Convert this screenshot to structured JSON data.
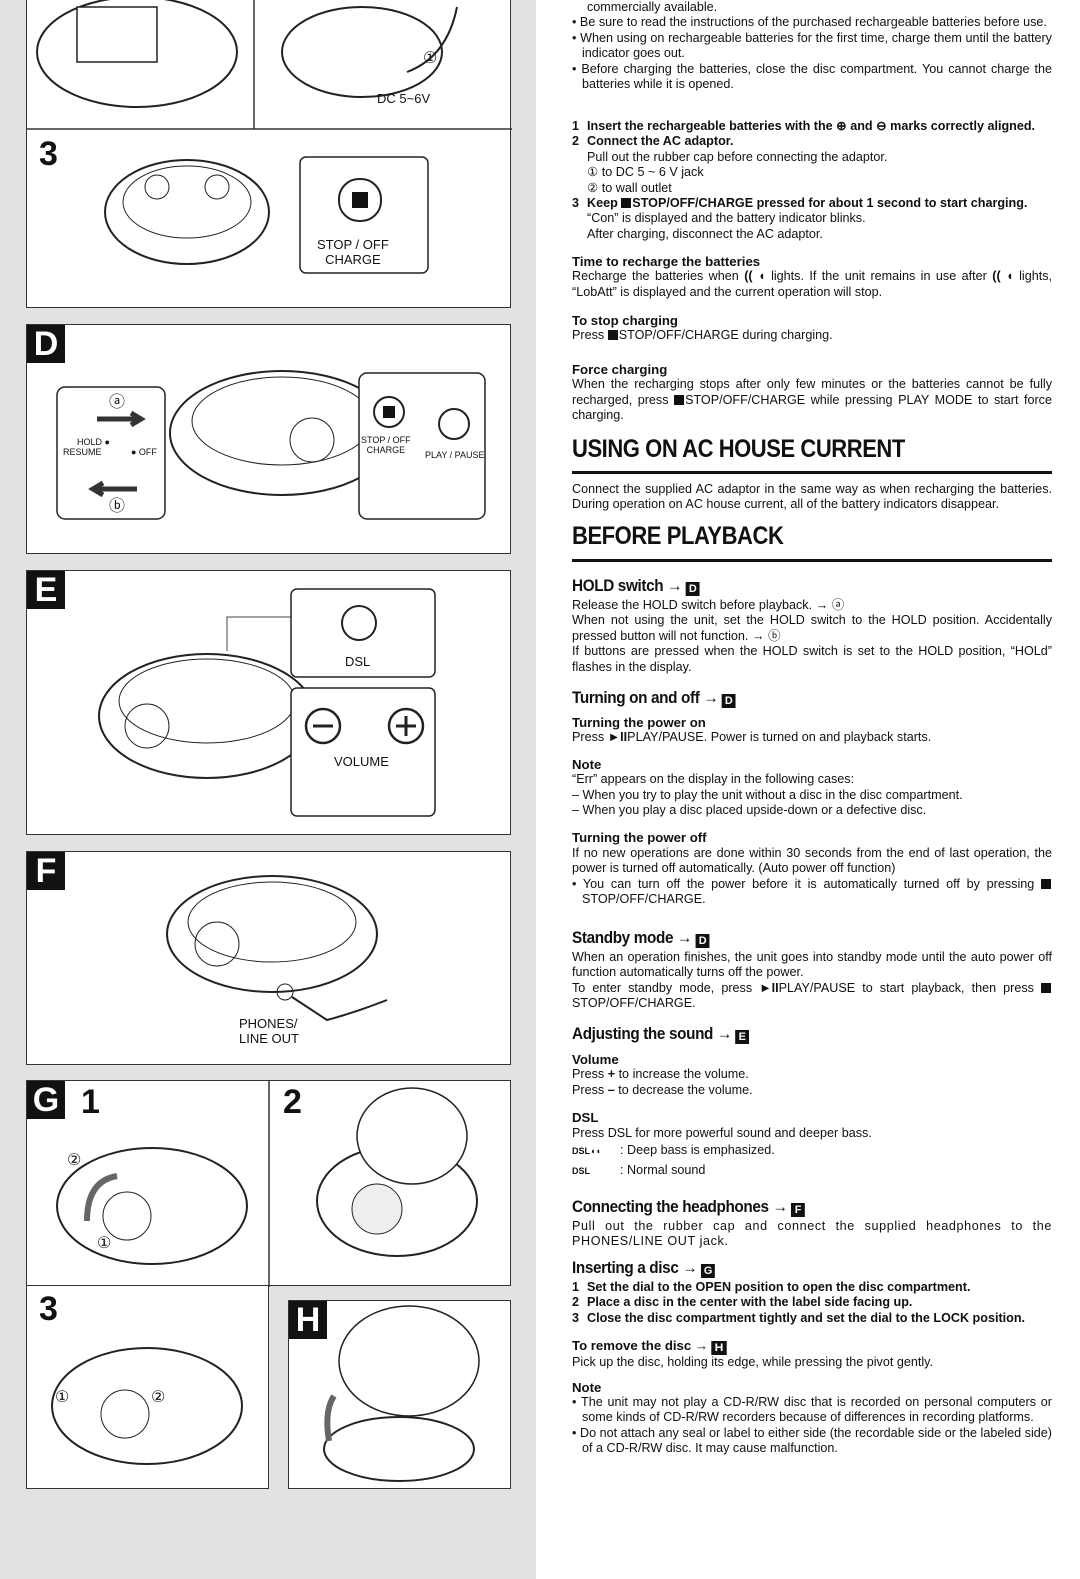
{
  "figures": {
    "top": {
      "dc_label": "DC 5~6V",
      "circle1": "①",
      "step3": "3",
      "stop_label": "STOP / OFF\nCHARGE"
    },
    "D": {
      "letter": "D",
      "a": "ⓐ",
      "b": "ⓑ",
      "hold": "HOLD ●",
      "resume": "RESUME",
      "off": "● OFF",
      "stop": "STOP / OFF\nCHARGE",
      "play": "PLAY / PAUSE"
    },
    "E": {
      "letter": "E",
      "dsl": "DSL",
      "volume": "VOLUME"
    },
    "F": {
      "letter": "F",
      "phones": "PHONES/\nLINE OUT"
    },
    "G": {
      "letter": "G",
      "step1": "1",
      "step2": "2",
      "step3": "3",
      "c1": "①",
      "c2": "②"
    },
    "H": {
      "letter": "H"
    }
  },
  "charging": {
    "intro": [
      "commercially available.",
      "Be sure to read the instructions of the purchased rechargeable batteries before use.",
      "When using on rechargeable batteries for the first time, charge them until the battery indicator goes out.",
      "Before charging the batteries, close the disc compartment. You cannot charge the batteries while it is opened."
    ],
    "steps": [
      {
        "n": "1",
        "text": "Insert the rechargeable batteries with the ⊕ and ⊖ marks correctly aligned."
      },
      {
        "n": "2",
        "text": "Connect the AC adaptor.",
        "details": [
          "Pull out the rubber cap before connecting the adaptor.",
          "① to DC 5 ~ 6 V jack",
          "② to wall outlet"
        ]
      },
      {
        "n": "3",
        "text": "STOP/OFF/CHARGE pressed for about 1 second to start charging.",
        "pre": "Keep",
        "details": [
          "“Con” is displayed and the battery indicator blinks.",
          "After charging, disconnect the AC adaptor."
        ]
      }
    ],
    "time_title": "Time to recharge the batteries",
    "time_text_1": "Recharge the batteries when",
    "time_text_2": "lights. If the unit remains in use after",
    "time_text_3": "lights, “LobAtt” is displayed and the current operation will stop.",
    "stop_title": "To stop charging",
    "stop_pre": "Press",
    "stop_text": "STOP/OFF/CHARGE during charging.",
    "force_title": "Force charging",
    "force_text_1": "When the recharging stops after only few minutes or the batteries cannot be fully recharged, press",
    "force_text_2": "STOP/OFF/CHARGE while pressing PLAY MODE to start force charging."
  },
  "ac": {
    "title": "USING ON AC HOUSE CURRENT",
    "text": "Connect the supplied AC adaptor in the same way as when recharging the batteries. During operation on AC house current, all of the battery indicators disappear."
  },
  "playback": {
    "title": "BEFORE PLAYBACK",
    "arrow": "→",
    "hold": {
      "title": "HOLD switch",
      "ref": "D",
      "lines": [
        "Release the HOLD switch before playback. → ⓐ",
        "When not using the unit, set the HOLD switch to the HOLD position. Accidentally pressed button will not function. → ⓑ",
        "If buttons are pressed when the HOLD switch is set to the HOLD position, “HOLd” flashes in the display."
      ]
    },
    "onoff": {
      "title": "Turning on and off",
      "ref": "D",
      "on_title": "Turning the power on",
      "on_pre": "Press",
      "on_icon": "►II",
      "on_text": "PLAY/PAUSE. Power is turned on and playback starts.",
      "note_title": "Note",
      "note_lines": [
        "“Err” appears on the display in the following cases:",
        "– When you try to play the unit without a disc in the disc compartment.",
        "– When you play a disc placed upside-down or a defective disc."
      ],
      "off_title": "Turning the power off",
      "off_text": "If no new operations are done within 30 seconds from the end of last operation, the power is turned off automatically. (Auto power off function)",
      "off_bullet": "You can turn off the power before it is automatically turned off by pressing",
      "off_bullet_2": "STOP/OFF/CHARGE."
    },
    "standby": {
      "title": "Standby mode",
      "ref": "D",
      "text": "When an operation finishes, the unit goes into standby mode until the auto power off function automatically turns off the power.",
      "text2_pre": "To enter standby mode, press",
      "text2_icon": "►II",
      "text2": "PLAY/PAUSE to start playback, then press",
      "text2_end": "STOP/OFF/CHARGE."
    },
    "sound": {
      "title": "Adjusting the sound",
      "ref": "E",
      "vol_title": "Volume",
      "vol_lines": [
        {
          "pre": "Press",
          "icon": "+",
          "text": "to increase the volume."
        },
        {
          "pre": "Press",
          "icon": "–",
          "text": "to decrease the volume."
        }
      ],
      "dsl_title": "DSL",
      "dsl_text": "Press DSL for more powerful sound and deeper bass.",
      "dsl_items": [
        {
          "icon": "DSL◖◖",
          "text": ": Deep bass is emphasized."
        },
        {
          "icon": "DSL",
          "text": ": Normal sound"
        }
      ]
    },
    "headphones": {
      "title": "Connecting the headphones",
      "ref": "F",
      "text": "Pull out the rubber cap and connect the supplied headphones to the PHONES/LINE OUT jack."
    },
    "disc": {
      "title": "Inserting a disc",
      "ref": "G",
      "steps": [
        {
          "n": "1",
          "text": "Set the dial to the OPEN position to open the disc compartment."
        },
        {
          "n": "2",
          "text": "Place a disc in the center with the label side facing up."
        },
        {
          "n": "3",
          "text": "Close the disc compartment tightly and set the dial to the LOCK position."
        }
      ],
      "remove_title": "To remove the disc",
      "remove_ref": "H",
      "remove_text": "Pick up the disc, holding its edge, while pressing the pivot gently.",
      "note_title": "Note",
      "notes": [
        "The unit may not play a CD-R/RW disc that is recorded on personal computers or some kinds of CD-R/RW recorders because of differences in recording platforms.",
        "Do not attach any seal or label to either side (the recordable side or the labeled side) of a CD-R/RW disc. It may cause malfunction."
      ]
    }
  }
}
